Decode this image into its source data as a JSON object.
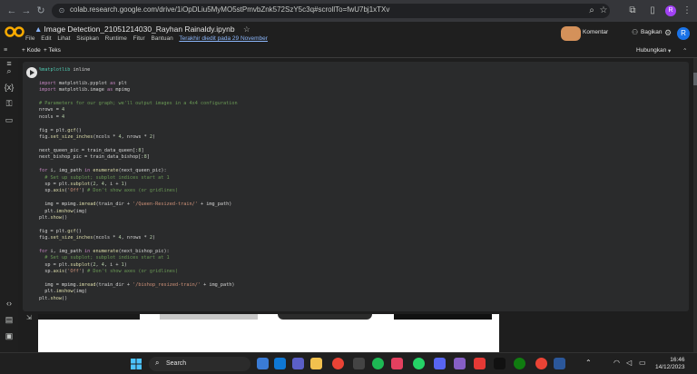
{
  "browser": {
    "url": "colab.research.google.com/drive/1iOpDLiu5MyMO5stPmvbZnk572SzY5c3q#scrollTo=fwU7bj1xTXv",
    "profile_initial": "R"
  },
  "notebook": {
    "title": "Image Detection_21051214030_Rayhan Rainaldy.ipynb",
    "menu": [
      "File",
      "Edit",
      "Lihat",
      "Sisipkan",
      "Runtime",
      "Fitur",
      "Bantuan"
    ],
    "last_edited": "Terakhir diedit pada 29 November",
    "comment": "Komentar",
    "share": "Bagikan",
    "user_initial": "R"
  },
  "toolbar": {
    "code": "+ Kode",
    "text": "+ Teks",
    "connect": "Hubungkan"
  },
  "taskbar": {
    "search": "Search",
    "time": "16:46",
    "date": "14/12/2023"
  },
  "colors": {
    "accent": "#f9ab00",
    "link": "#8ab4f8"
  },
  "icons": [
    "back-icon",
    "forward-icon",
    "reload-icon",
    "search-icon",
    "star-icon",
    "extensions-icon",
    "sidebar-icon",
    "menu-icon",
    "settings-icon",
    "windows-start-icon"
  ]
}
